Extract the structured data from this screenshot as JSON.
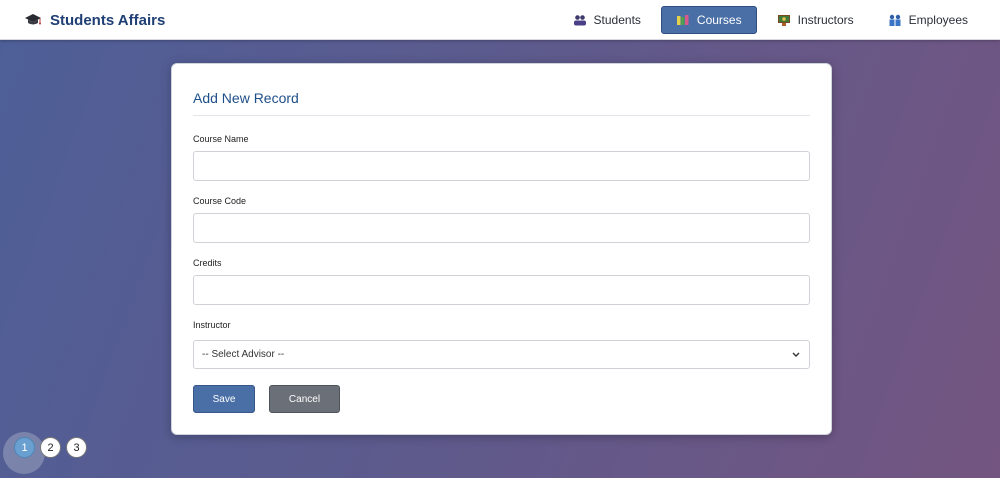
{
  "app": {
    "title": "Students Affairs",
    "logo_icon": "graduation-cap-icon"
  },
  "nav": {
    "items": [
      {
        "label": "Students",
        "icon": "students-icon",
        "active": false
      },
      {
        "label": "Courses",
        "icon": "books-icon",
        "active": true
      },
      {
        "label": "Instructors",
        "icon": "instructor-icon",
        "active": false
      },
      {
        "label": "Employees",
        "icon": "employees-icon",
        "active": false
      }
    ]
  },
  "form": {
    "title": "Add New Record",
    "fields": [
      {
        "label": "Course Name",
        "value": "",
        "placeholder": ""
      },
      {
        "label": "Course Code",
        "value": "",
        "placeholder": ""
      },
      {
        "label": "Credits",
        "value": "",
        "placeholder": ""
      }
    ],
    "instructor": {
      "label": "Instructor",
      "selected": "-- Select Advisor --"
    },
    "save_label": "Save",
    "cancel_label": "Cancel"
  },
  "pagination": {
    "pages": [
      "1",
      "2",
      "3"
    ],
    "current": "1"
  },
  "colors": {
    "accent": "#4a6fa6",
    "brand_text": "#1f3f74",
    "cancel": "#6b7078"
  }
}
